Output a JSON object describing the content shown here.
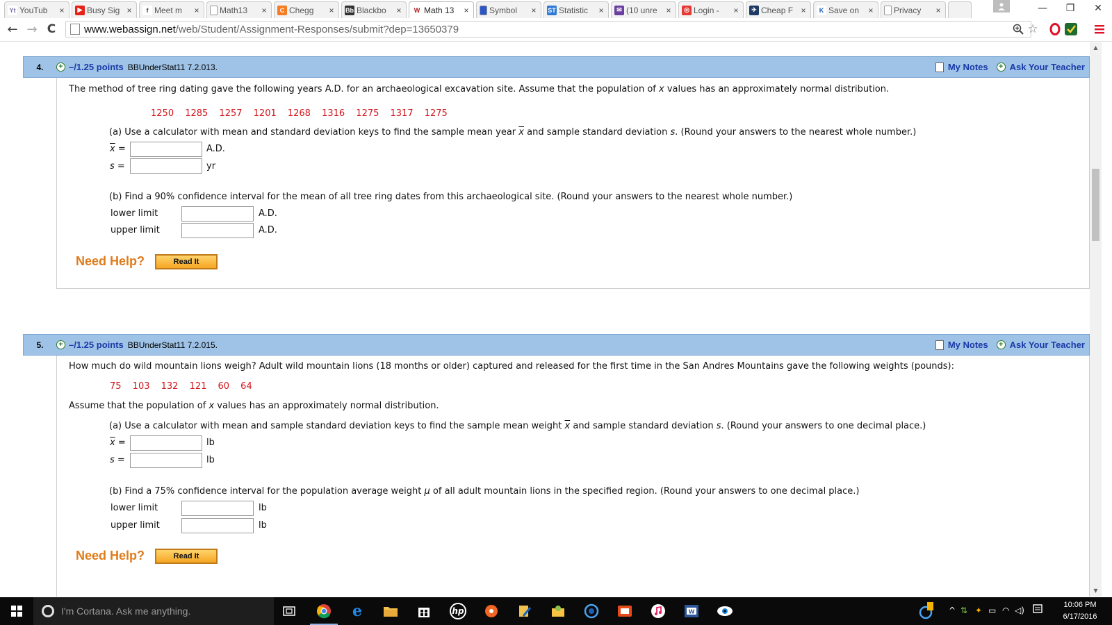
{
  "browser": {
    "tabs": [
      {
        "label": "YouTub",
        "fav_text": "Yt",
        "fav_color": "#ffffff",
        "fav_fg": "#7b6ea8"
      },
      {
        "label": "Busy Sig",
        "fav_text": "▶",
        "fav_color": "#e62117",
        "fav_fg": "#ffffff"
      },
      {
        "label": "Meet m",
        "fav_text": "f",
        "fav_color": "#ffffff",
        "fav_fg": "#444444"
      },
      {
        "label": "Math13",
        "fav_text": "",
        "fav_color": "#ffffff",
        "fav_fg": "#888888"
      },
      {
        "label": "Chegg",
        "fav_text": "C",
        "fav_color": "#f57c22",
        "fav_fg": "#ffffff"
      },
      {
        "label": "Blackbo",
        "fav_text": "Bb",
        "fav_color": "#333333",
        "fav_fg": "#ffffff"
      },
      {
        "label": "Math 13",
        "fav_text": "W",
        "fav_color": "#ffffff",
        "fav_fg": "#b01b1b"
      },
      {
        "label": "Symbol",
        "fav_text": "",
        "fav_color": "#2a56c6",
        "fav_fg": "#ffffff"
      },
      {
        "label": "Statistic",
        "fav_text": "ST",
        "fav_color": "#2f7bd6",
        "fav_fg": "#ffffff"
      },
      {
        "label": "(10 unre",
        "fav_text": "✉",
        "fav_color": "#6b3fa0",
        "fav_fg": "#ffffff"
      },
      {
        "label": "Login -",
        "fav_text": "◎",
        "fav_color": "#e53935",
        "fav_fg": "#ffffff"
      },
      {
        "label": "Cheap F",
        "fav_text": "✈",
        "fav_color": "#1f3b63",
        "fav_fg": "#ffffff"
      },
      {
        "label": "Save on",
        "fav_text": "K",
        "fav_color": "#ffffff",
        "fav_fg": "#1b5fbf"
      },
      {
        "label": "Privacy",
        "fav_text": "",
        "fav_color": "#ffffff",
        "fav_fg": "#888888"
      }
    ],
    "active_tab_index": 6,
    "tab_close": "×",
    "url_host": "www.webassign.net",
    "url_path": "/web/Student/Assignment-Responses/submit?dep=13650379",
    "nav_back": "←",
    "nav_forward": "→",
    "nav_reload": "C",
    "win_min": "—",
    "win_restore": "❐",
    "win_close": "✕"
  },
  "common": {
    "my_notes": "My Notes",
    "ask_teacher": "Ask Your Teacher",
    "need_help": "Need Help?",
    "read_it": "Read It",
    "plus": "+"
  },
  "q4": {
    "number": "4.",
    "points": "–/1.25 points",
    "ref": "BBUnderStat11 7.2.013.",
    "prompt_a": "The method of tree ring dating gave the following years A.D. for an archaeological excavation site. Assume that the population of ",
    "prompt_x": "x",
    "prompt_b": " values has an approximately normal distribution.",
    "data": "1250   1285   1257   1201   1268   1316   1275   1317   1275",
    "part_a_1": "(a) Use a calculator with mean and standard deviation keys to find the sample mean year ",
    "part_a_x": "x",
    "part_a_2": " and sample standard deviation ",
    "part_a_s": "s",
    "part_a_3": ". (Round your answers to the nearest whole number.)",
    "xbar_label": "x",
    "eq": " =",
    "s_label": "s",
    "xbar_unit": "A.D.",
    "s_unit": "yr",
    "part_b": "(b) Find a 90% confidence interval for the mean of all tree ring dates from this archaeological site. (Round your answers to the nearest whole number.)",
    "lower_label": "lower limit",
    "upper_label": "upper limit",
    "lower_unit": "A.D.",
    "upper_unit": "A.D."
  },
  "q5": {
    "number": "5.",
    "points": "–/1.25 points",
    "ref": "BBUnderStat11 7.2.015.",
    "prompt": "How much do wild mountain lions weigh? Adult wild mountain lions (18 months or older) captured and released for the first time in the San Andres Mountains gave the following weights (pounds):",
    "data": "75   103   132   121   60   64",
    "assume_a": "Assume that the population of ",
    "assume_x": "x",
    "assume_b": " values has an approximately normal distribution.",
    "part_a_1": "(a) Use a calculator with mean and sample standard deviation keys to find the sample mean weight ",
    "part_a_x": "x",
    "part_a_2": " and sample standard deviation ",
    "part_a_s": "s",
    "part_a_3": ". (Round your answers to one decimal place.)",
    "xbar_label": "x",
    "eq": " =",
    "s_label": "s",
    "xbar_unit": "lb",
    "s_unit": "lb",
    "part_b_1": "(b) Find a 75% confidence interval for the population average weight ",
    "part_b_mu": "μ",
    "part_b_2": " of all adult mountain lions in the specified region. (Round your answers to one decimal place.)",
    "lower_label": "lower limit",
    "upper_label": "upper limit",
    "lower_unit": "lb",
    "upper_unit": "lb"
  },
  "taskbar": {
    "cortana_placeholder": "I'm Cortana. Ask me anything.",
    "time": "10:06 PM",
    "date": "6/17/2016"
  },
  "colors": {
    "header_bg": "#9fc3e7",
    "link": "#1a3aa8",
    "data_red": "#d2161c",
    "help_orange": "#e07b1a"
  }
}
